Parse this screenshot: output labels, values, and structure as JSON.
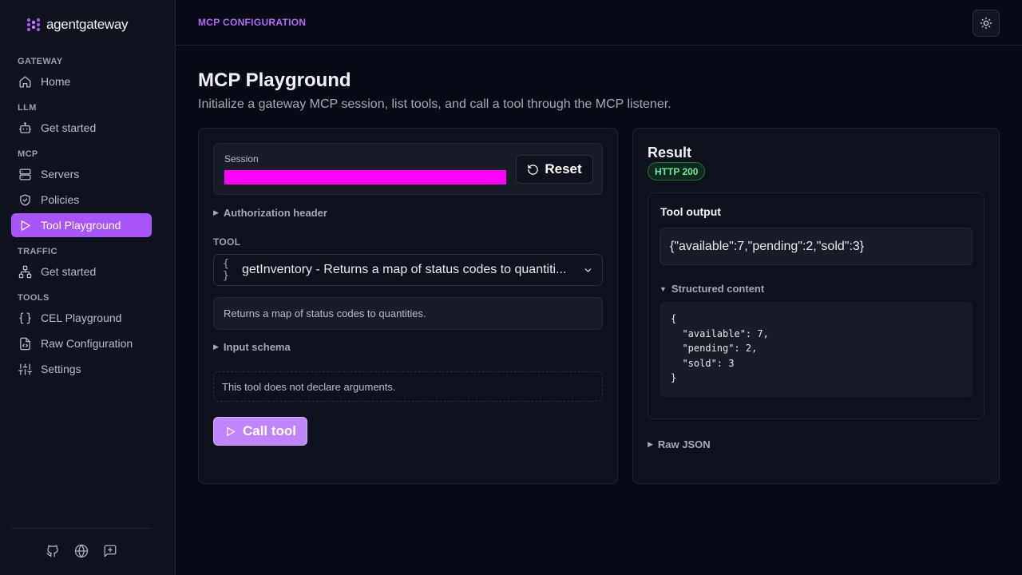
{
  "app": {
    "logo_text": "agentgateway"
  },
  "sidebar": {
    "sections": [
      {
        "label": "GATEWAY",
        "items": [
          {
            "label": "Home",
            "icon": "home-icon"
          }
        ]
      },
      {
        "label": "LLM",
        "items": [
          {
            "label": "Get started",
            "icon": "bot-icon"
          }
        ]
      },
      {
        "label": "MCP",
        "items": [
          {
            "label": "Servers",
            "icon": "server-icon"
          },
          {
            "label": "Policies",
            "icon": "shield-icon"
          },
          {
            "label": "Tool Playground",
            "icon": "play-icon",
            "active": true
          }
        ]
      },
      {
        "label": "TRAFFIC",
        "items": [
          {
            "label": "Get started",
            "icon": "network-icon"
          }
        ]
      },
      {
        "label": "TOOLS",
        "items": [
          {
            "label": "CEL Playground",
            "icon": "braces-icon"
          },
          {
            "label": "Raw Configuration",
            "icon": "file-code-icon"
          },
          {
            "label": "Settings",
            "icon": "sliders-icon"
          }
        ]
      }
    ],
    "footer_icons": [
      "github-icon",
      "globe-icon",
      "feedback-icon"
    ]
  },
  "header": {
    "breadcrumb": "MCP CONFIGURATION",
    "theme_icon": "sun-icon"
  },
  "page": {
    "title": "MCP Playground",
    "subtitle": "Initialize a gateway MCP session, list tools, and call a tool through the MCP listener."
  },
  "left_panel": {
    "session_label": "Session",
    "reset_label": "Reset",
    "authorization_label": "Authorization header",
    "tool_label": "TOOL",
    "tool_icon_text": "{ }",
    "tool_selected": "getInventory - Returns a map of status codes to quantiti...",
    "tool_description": "Returns a map of status codes to quantities.",
    "input_schema_label": "Input schema",
    "no_args_text": "This tool does not declare arguments.",
    "call_label": "Call tool"
  },
  "right_panel": {
    "title": "Result",
    "status_badge": "HTTP 200",
    "tool_output_label": "Tool output",
    "tool_output_text": "{\"available\":7,\"pending\":2,\"sold\":3}",
    "structured_label": "Structured content",
    "structured_lines": [
      "{",
      "  \"available\": 7,",
      "  \"pending\": 2,",
      "  \"sold\": 3",
      "}"
    ],
    "raw_json_label": "Raw JSON"
  },
  "colors": {
    "accent": "#a855f7",
    "success": "#6ee7a1",
    "session_redacted": "#ff00ff"
  }
}
